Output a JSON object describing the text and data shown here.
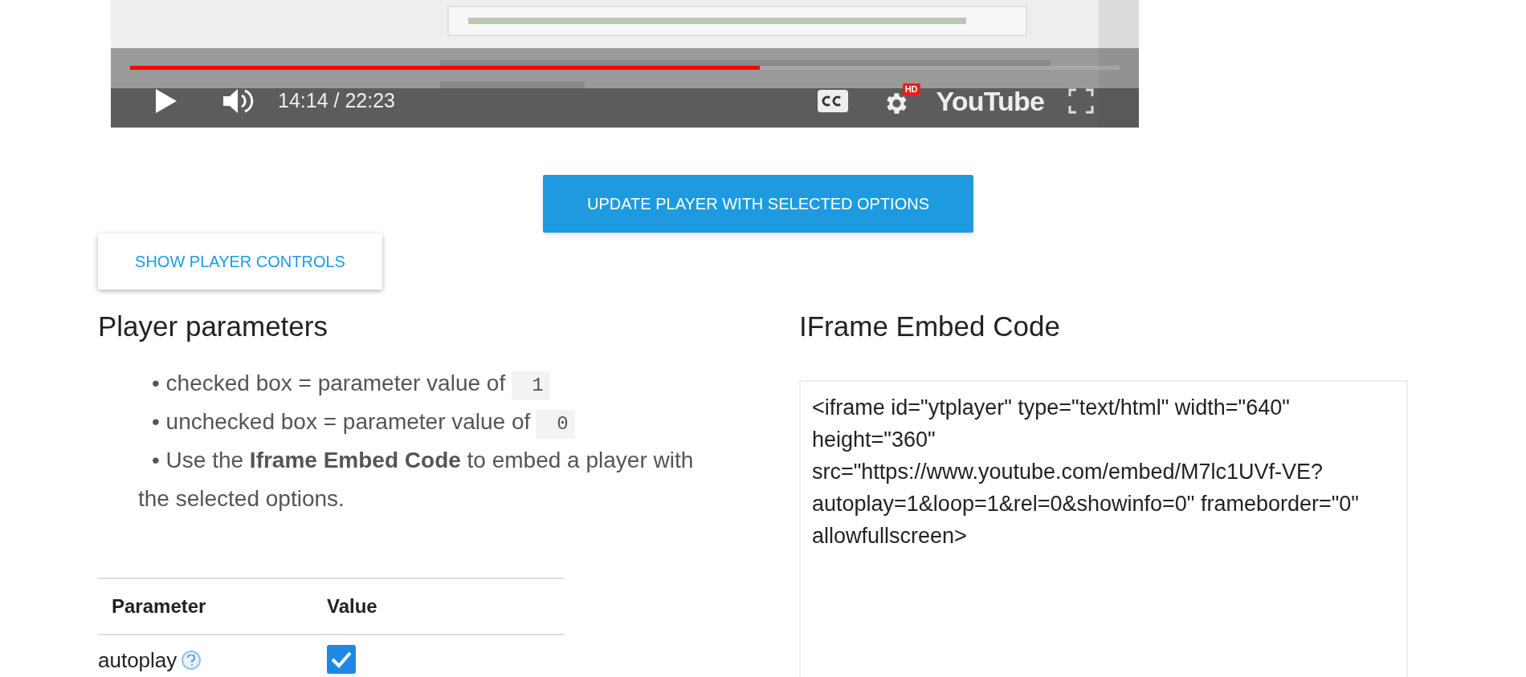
{
  "player": {
    "progress": {
      "level": 0.636
    },
    "time": "14:14 / 22:23",
    "hd_badge": "HD",
    "logo": "YouTube"
  },
  "update_button": "UPDATE PLAYER WITH SELECTED OPTIONS",
  "controls_button": "SHOW PLAYER CONTROLS",
  "parameters": {
    "title": "Player parameters",
    "notes": [
      {
        "text": "• checked box = parameter value of",
        "code": "1"
      },
      {
        "text": "• unchecked box = parameter value of",
        "code": "0"
      },
      {
        "text": "• Use the **Iframe Embed Code** to embed a player with the selected options."
      }
    ],
    "table": {
      "columns": [
        "Parameter",
        "Value"
      ],
      "rows": [
        {
          "name": "autoplay",
          "checked": true
        }
      ]
    }
  },
  "embed": {
    "title": "IFrame Embed Code",
    "code": "<iframe id=\"ytplayer\" type=\"text/html\" width=\"640\" height=\"360\" src=\"https://www.youtube.com/embed/M7lc1UVf-VE?autoplay=1&loop=1&rel=0&showinfo=0\" frameborder=\"0\" allowfullscreen>"
  }
}
